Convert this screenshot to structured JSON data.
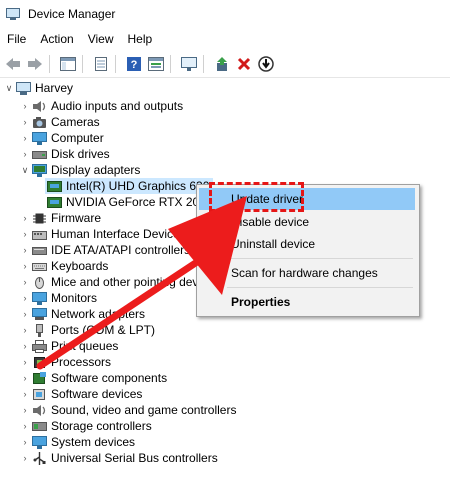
{
  "window": {
    "title": "Device Manager"
  },
  "menu": [
    "File",
    "Action",
    "View",
    "Help"
  ],
  "tree": {
    "root": "Harvey",
    "categories": [
      "Audio inputs and outputs",
      "Cameras",
      "Computer",
      "Disk drives",
      "Display adapters",
      "Intel(R) UHD Graphics 630",
      "NVIDIA GeForce RTX 2060",
      "Firmware",
      "Human Interface Devices",
      "IDE ATA/ATAPI controllers",
      "Keyboards",
      "Mice and other pointing devices",
      "Monitors",
      "Network adapters",
      "Ports (COM & LPT)",
      "Print queues",
      "Processors",
      "Software components",
      "Software devices",
      "Sound, video and game controllers",
      "Storage controllers",
      "System devices",
      "Universal Serial Bus controllers"
    ]
  },
  "context_menu": {
    "update": "Update driver",
    "disable": "Disable device",
    "uninstall": "Uninstall device",
    "scan": "Scan for hardware changes",
    "properties": "Properties"
  },
  "colors": {
    "highlight": "#91c9f7",
    "selection": "#cce8ff",
    "annotation": "#e51616"
  }
}
